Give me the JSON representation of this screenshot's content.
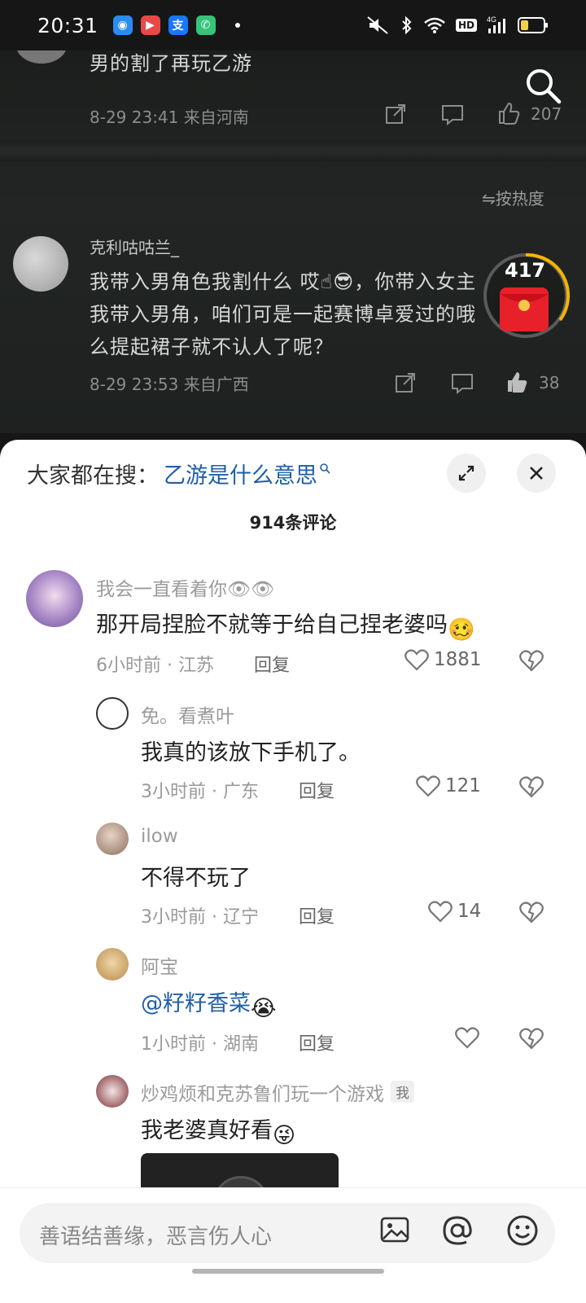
{
  "status_bar": {
    "time": "20:31",
    "app_icons": [
      "browser-icon",
      "video-app-icon",
      "alipay-icon",
      "phone-icon"
    ],
    "right_icons": [
      "mute-icon",
      "bluetooth-icon",
      "wifi-icon",
      "hd-icon",
      "signal-4g-icon",
      "battery-icon"
    ],
    "hd_label": "HD",
    "network_label": "4G"
  },
  "video": {
    "top_comment_text": "男的割了再玩乙游",
    "top_comment_meta": "8-29 23:41 来自河南",
    "top_comment_likes": "207",
    "sort_label": "按热度",
    "comment_author": "克利咕咕兰_",
    "comment_line1": "我带入男角色我割什么 哎",
    "comment_line1_b": "，你带入女主",
    "comment_line2": "我带入男角，咱们可是一起赛博卓爱过的哦",
    "comment_line3": "么提起裙子就不认人了呢？",
    "comment_meta": "8-29 23:53 来自广西",
    "comment_likes": "38",
    "redpacket_count": "417"
  },
  "sheet": {
    "hot_search_label": "大家都在搜：",
    "hot_search_query": "乙游是什么意思",
    "comment_count_title": "914条评论"
  },
  "comments": [
    {
      "author": "我会一直看着你",
      "text": "那开局捏脸不就等于给自己捏老婆吗",
      "meta": "6小时前 · 江苏",
      "reply": "回复",
      "likes": "1881"
    },
    {
      "author": "免。看煮叶",
      "text": "我真的该放下手机了。",
      "meta": "3小时前 · 广东",
      "reply": "回复",
      "likes": "121"
    },
    {
      "author": "ilow",
      "text": "不得不玩了",
      "meta": "3小时前 · 辽宁",
      "reply": "回复",
      "likes": "14"
    },
    {
      "author": "阿宝",
      "text": "@籽籽香菜",
      "meta": "1小时前 · 湖南",
      "reply": "回复",
      "likes": ""
    },
    {
      "author": "炒鸡烦和克苏鲁们玩一个游戏",
      "badge": "我",
      "text": "我老婆真好看",
      "meta": "",
      "reply": "",
      "likes": ""
    }
  ],
  "input": {
    "placeholder": "善语结善缘，恶言伤人心"
  },
  "colors": {
    "link_blue": "#1f5fa8",
    "redpacket_red": "#e8202a",
    "redpacket_ring": "#f5b400"
  }
}
